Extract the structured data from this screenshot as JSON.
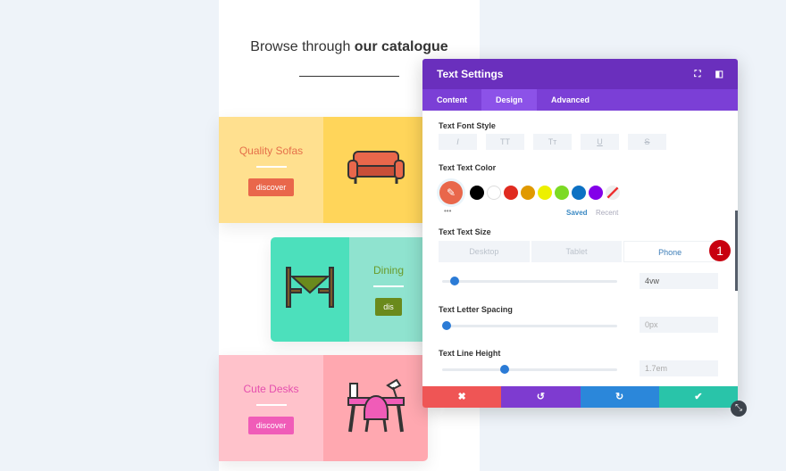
{
  "page": {
    "heading_light": "Browse through ",
    "heading_bold": "our catalogue"
  },
  "cards": [
    {
      "title": "Quality Sofas",
      "button": "discover",
      "icon": "sofa-icon",
      "bg_text": "#ffe08f",
      "bg_icon": "#ffd55a",
      "text_color": "#e5704a",
      "button_color": "#e9674b"
    },
    {
      "title": "Dining",
      "button": "dis",
      "icon": "dining-table-icon",
      "bg_text": "#8fe3cf",
      "bg_icon": "#4ce0bc",
      "text_color": "#6a9a2a",
      "button_color": "#6a8a1c"
    },
    {
      "title": "Cute Desks",
      "button": "discover",
      "icon": "desk-icon",
      "bg_text": "#ffc2cb",
      "bg_icon": "#ffa8b0",
      "text_color": "#e54fae",
      "button_color": "#f05cb8"
    }
  ],
  "modal": {
    "title": "Text Settings",
    "tabs": [
      "Content",
      "Design",
      "Advanced"
    ],
    "active_tab": "Design",
    "font_style_label": "Text Font Style",
    "font_styles": [
      "I",
      "TT",
      "Tт",
      "U",
      "S"
    ],
    "color_label": "Text Text Color",
    "selected_color": "#e9674b",
    "swatches": [
      "#000000",
      "#ffffff",
      "#e02b20",
      "#e09900",
      "#edf000",
      "#7cda24",
      "#0c71c3",
      "#8300e9"
    ],
    "saved": "Saved",
    "recent": "Recent",
    "more": "•••",
    "size_label": "Text Text Size",
    "devices": [
      "Desktop",
      "Tablet",
      "Phone"
    ],
    "active_device": "Phone",
    "size_value": "4vw",
    "size_slider": 0.05,
    "spacing_label": "Text Letter Spacing",
    "spacing_value": "0px",
    "spacing_slider": 0,
    "lineheight_label": "Text Line Height",
    "lineheight_value": "1.7em",
    "lineheight_slider": 0.35,
    "footer": [
      {
        "icon": "close-icon",
        "glyph": "✖",
        "color": "#ef5555"
      },
      {
        "icon": "undo-icon",
        "glyph": "↺",
        "color": "#7e3bd0"
      },
      {
        "icon": "redo-icon",
        "glyph": "↻",
        "color": "#2b87da"
      },
      {
        "icon": "check-icon",
        "glyph": "✔",
        "color": "#29c4a9"
      }
    ]
  },
  "badge": "1"
}
